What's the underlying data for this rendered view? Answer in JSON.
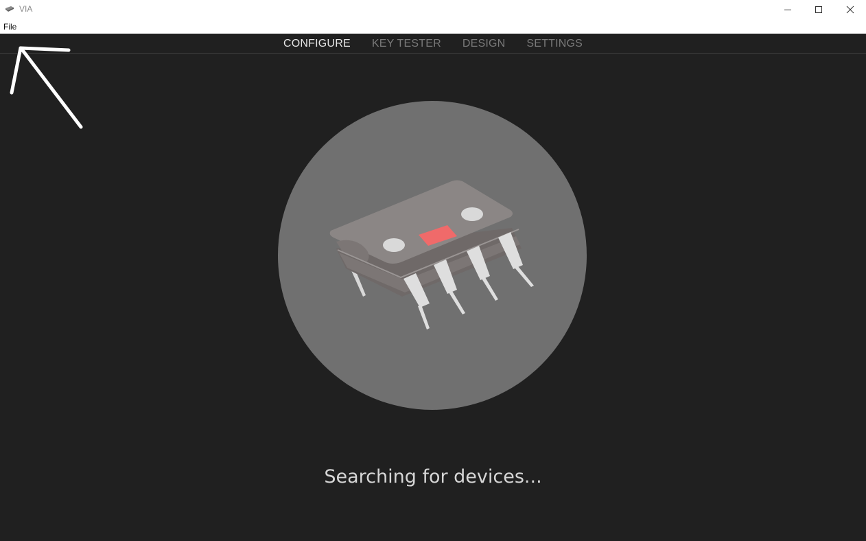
{
  "window": {
    "title": "VIA",
    "icon": "keyboard-app-icon"
  },
  "menu": {
    "file_label": "File"
  },
  "nav": {
    "tabs": [
      {
        "label": "CONFIGURE",
        "active": true
      },
      {
        "label": "KEY TESTER",
        "active": false
      },
      {
        "label": "DESIGN",
        "active": false
      },
      {
        "label": "SETTINGS",
        "active": false
      }
    ]
  },
  "main": {
    "illustration": "microchip-icon",
    "status": "Searching for devices..."
  },
  "colors": {
    "background": "#202020",
    "circle": "#707070",
    "chip_body": "#8b8685",
    "chip_accent": "#f06a6a",
    "active_tab": "#e6e6e6",
    "inactive_tab": "#7a7a7a"
  }
}
